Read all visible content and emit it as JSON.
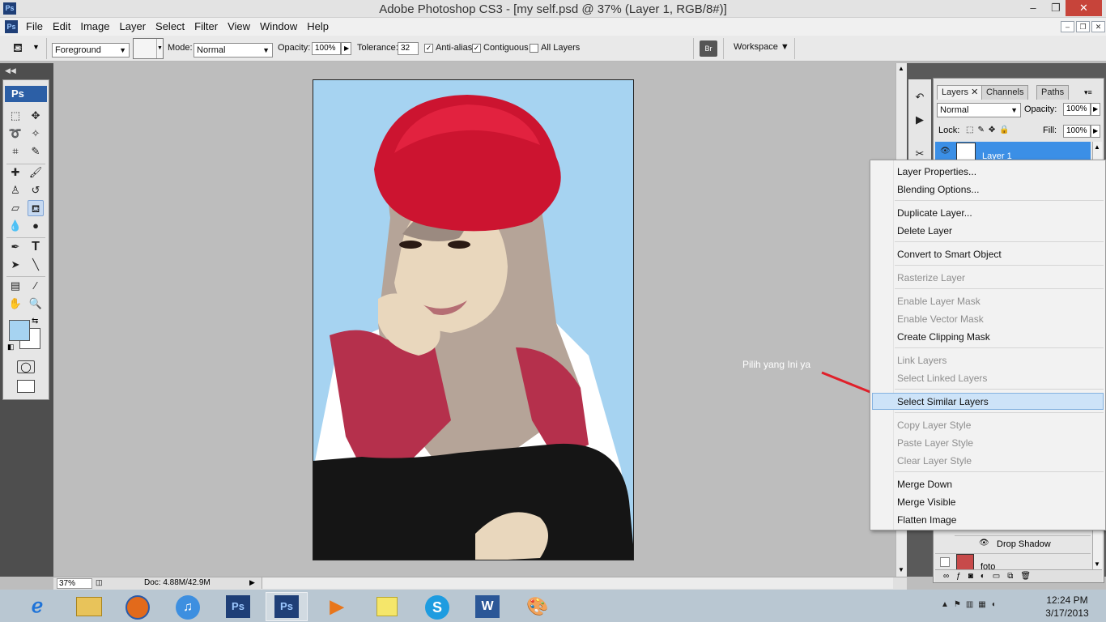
{
  "window": {
    "title": "Adobe Photoshop CS3 - [my self.psd @ 37% (Layer 1, RGB/8#)]",
    "app_badge": "Ps",
    "minimize": "–",
    "maximize": "❐",
    "close": "✕"
  },
  "menu": {
    "items": [
      "File",
      "Edit",
      "Image",
      "Layer",
      "Select",
      "Filter",
      "View",
      "Window",
      "Help"
    ],
    "mdi_min": "–",
    "mdi_max": "❐",
    "mdi_close": "✕"
  },
  "options": {
    "fill_source": "Foreground",
    "mode_label": "Mode:",
    "mode_value": "Normal",
    "opacity_label": "Opacity:",
    "opacity_value": "100%",
    "tolerance_label": "Tolerance:",
    "tolerance_value": "32",
    "antialias_label": "Anti-alias",
    "antialias_checked": true,
    "contiguous_label": "Contiguous",
    "contiguous_checked": true,
    "alllayers_label": "All Layers",
    "alllayers_checked": false,
    "workspace_label": "Workspace ▼"
  },
  "toolbox": {
    "badge": "Ps",
    "foreground_color": "#a6d3f1",
    "background_color": "#ffffff"
  },
  "canvas": {
    "backdrop_color": "#a6d3f1",
    "annotation": "Pilih yang Ini ya"
  },
  "status": {
    "zoom": "37%",
    "doc_info": "Doc: 4.88M/42.9M"
  },
  "layers_panel": {
    "tabs": [
      "Layers",
      "Channels",
      "Paths"
    ],
    "blend_mode": "Normal",
    "opacity_label": "Opacity:",
    "opacity_value": "100%",
    "lock_label": "Lock:",
    "fill_label": "Fill:",
    "fill_value": "100%",
    "selected_layer": "Layer 1",
    "effect_name": "Drop Shadow",
    "bottom_layer": "foto"
  },
  "context_menu": {
    "items": [
      {
        "label": "Layer Properties...",
        "enabled": true
      },
      {
        "label": "Blending Options...",
        "enabled": true
      },
      {
        "label": "Duplicate Layer...",
        "enabled": true
      },
      {
        "label": "Delete Layer",
        "enabled": true
      },
      {
        "label": "Convert to Smart Object",
        "enabled": true
      },
      {
        "label": "Rasterize Layer",
        "enabled": false
      },
      {
        "label": "Enable Layer Mask",
        "enabled": false
      },
      {
        "label": "Enable Vector Mask",
        "enabled": false
      },
      {
        "label": "Create Clipping Mask",
        "enabled": true
      },
      {
        "label": "Link Layers",
        "enabled": false
      },
      {
        "label": "Select Linked Layers",
        "enabled": false
      },
      {
        "label": "Select Similar Layers",
        "enabled": true,
        "highlighted": true
      },
      {
        "label": "Copy Layer Style",
        "enabled": false
      },
      {
        "label": "Paste Layer Style",
        "enabled": false
      },
      {
        "label": "Clear Layer Style",
        "enabled": false
      },
      {
        "label": "Merge Down",
        "enabled": true
      },
      {
        "label": "Merge Visible",
        "enabled": true
      },
      {
        "label": "Flatten Image",
        "enabled": true
      }
    ]
  },
  "taskbar": {
    "photoshop_badge": "Ps",
    "time": "12:24 PM",
    "date": "3/17/2013"
  }
}
